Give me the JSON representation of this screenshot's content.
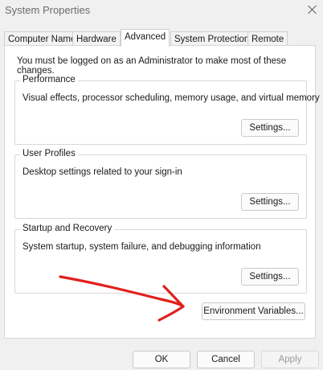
{
  "window": {
    "title": "System Properties"
  },
  "tabs": [
    {
      "label": "Computer Name"
    },
    {
      "label": "Hardware"
    },
    {
      "label": "Advanced"
    },
    {
      "label": "System Protection"
    },
    {
      "label": "Remote"
    }
  ],
  "active_tab": "Advanced",
  "advanced": {
    "admin_note": "You must be logged on as an Administrator to make most of these changes.",
    "performance": {
      "legend": "Performance",
      "description": "Visual effects, processor scheduling, memory usage, and virtual memory",
      "button": "Settings..."
    },
    "user_profiles": {
      "legend": "User Profiles",
      "description": "Desktop settings related to your sign-in",
      "button": "Settings..."
    },
    "startup_recovery": {
      "legend": "Startup and Recovery",
      "description": "System startup, system failure, and debugging information",
      "button": "Settings..."
    },
    "env_button": "Environment Variables..."
  },
  "footer": {
    "ok": "OK",
    "cancel": "Cancel",
    "apply": "Apply"
  },
  "colors": {
    "annotation": "#e0201c",
    "panel_bg": "#ffffff",
    "window_bg": "#f0f0f0"
  }
}
